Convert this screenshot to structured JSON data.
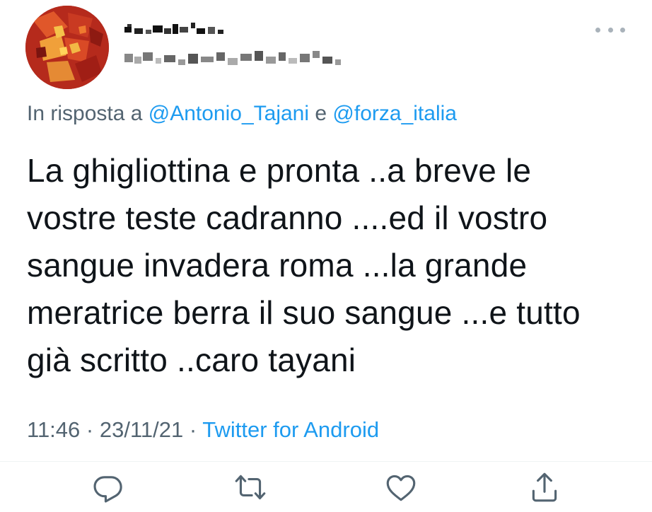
{
  "tweet": {
    "reply_to": {
      "prefix": "In risposta a",
      "mention1": "@Antonio_Tajani",
      "conjunction": "e",
      "mention2": "@forza_italia"
    },
    "body_lines": [
      "La ghigliottina e pronta ..a breve le",
      "vostre teste cadranno ....ed il vostro",
      "sangue invadera roma ...la grande",
      "meratrice berra il suo sangue ...e tutto",
      "già scritto ..caro tayani"
    ],
    "meta": {
      "time": "11:46",
      "separator": "·",
      "date": "23/11/21",
      "source": "Twitter for Android"
    }
  },
  "icons": {
    "more": "more-dots-icon",
    "reply": "reply-bubble-icon",
    "retweet": "retweet-icon",
    "like": "heart-icon",
    "share": "share-icon"
  },
  "colors": {
    "text": "#0f1419",
    "secondary": "#536471",
    "link": "#1d9bf0",
    "icon": "#536471"
  }
}
